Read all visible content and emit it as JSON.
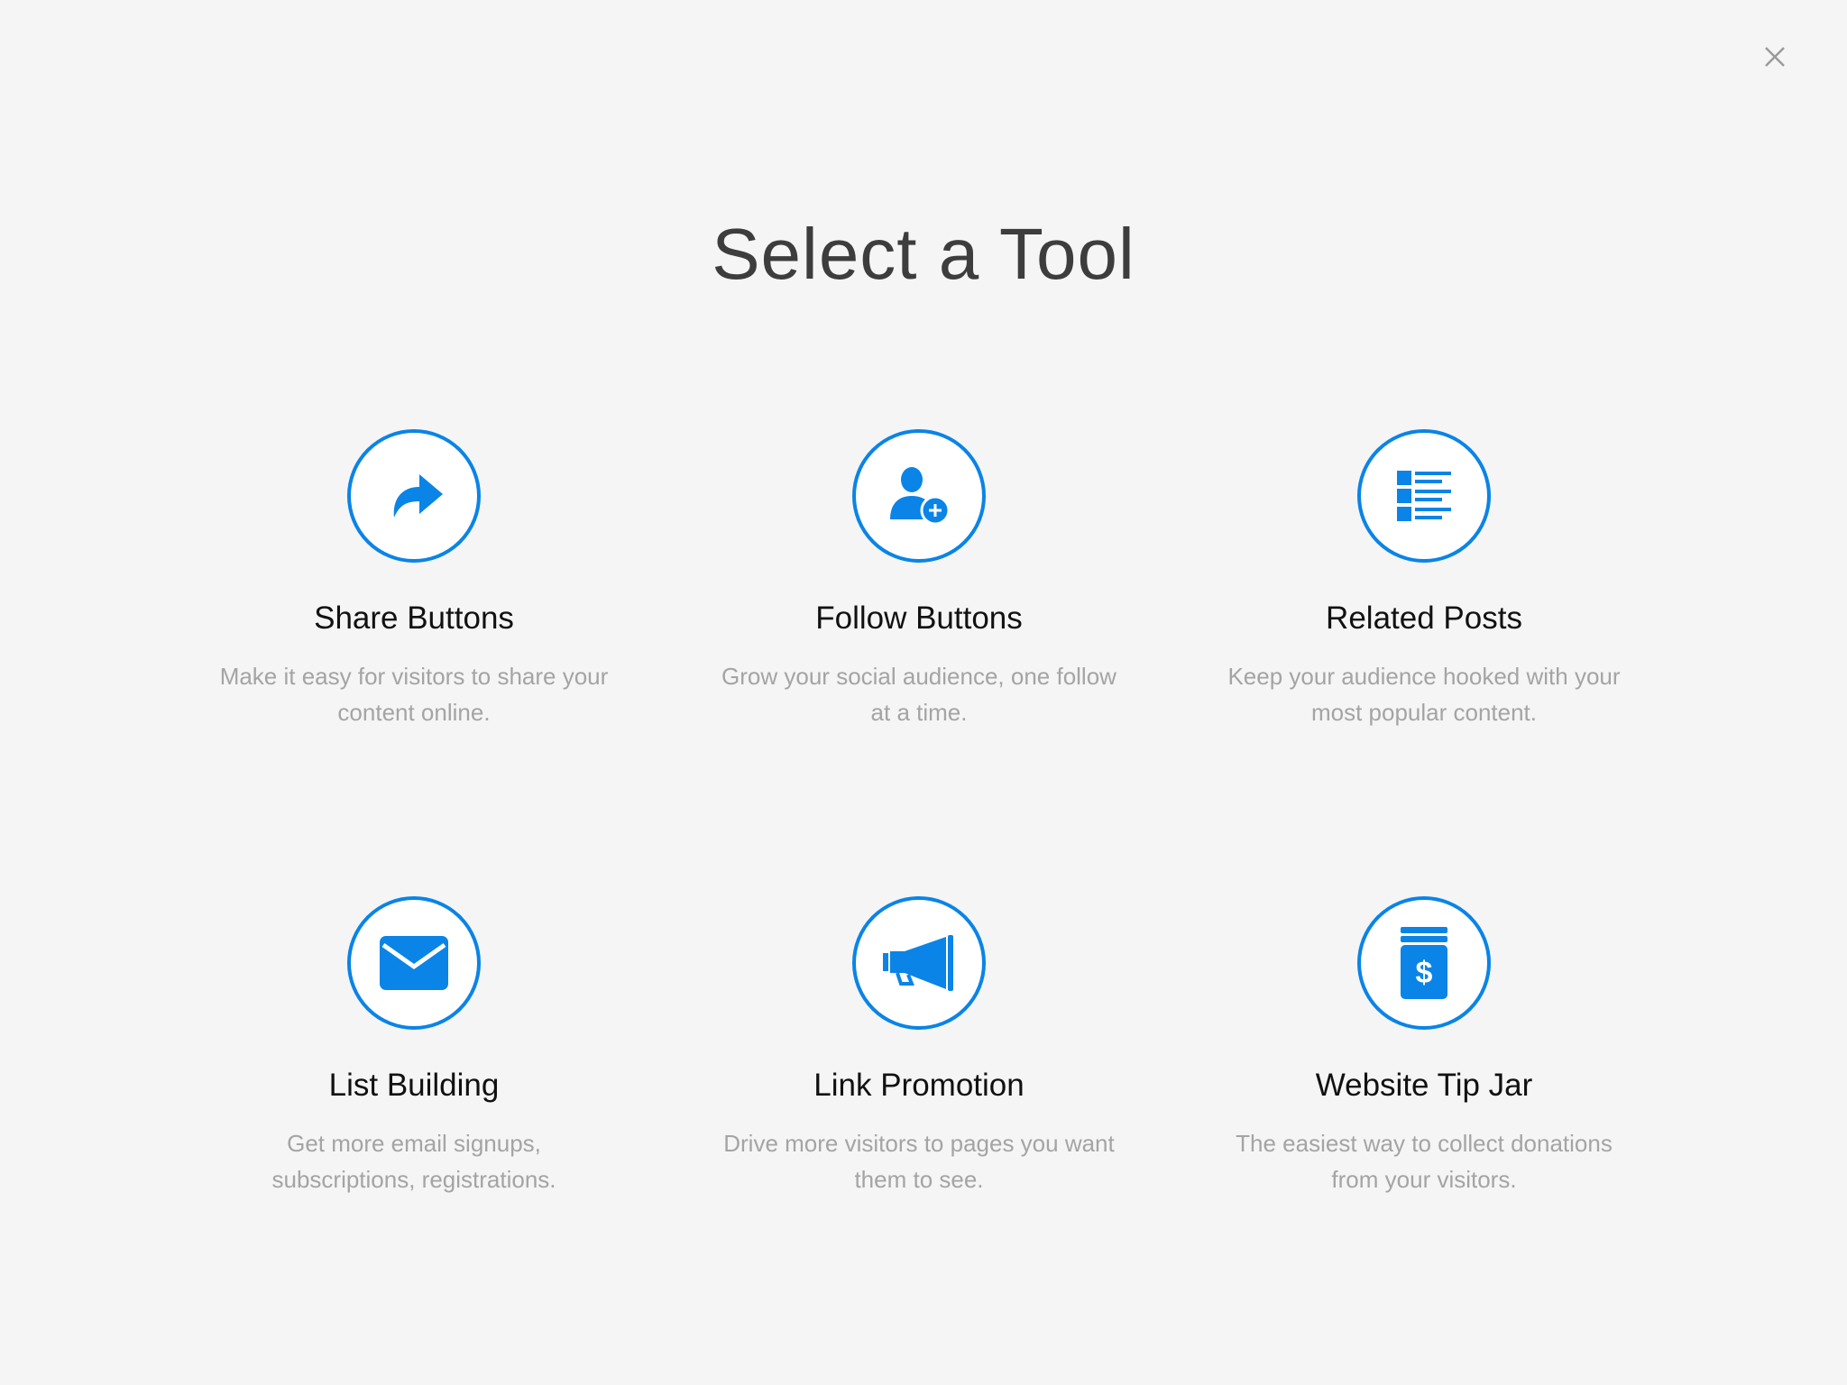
{
  "page": {
    "title": "Select a Tool",
    "close_icon": "close-icon",
    "accent_color": "#0a84e6"
  },
  "tools": [
    {
      "name": "Share Buttons",
      "description": "Make it easy for visitors to share your content online.",
      "icon": "share-arrow-icon"
    },
    {
      "name": "Follow Buttons",
      "description": "Grow your social audience, one follow at a time.",
      "icon": "add-follower-icon"
    },
    {
      "name": "Related Posts",
      "description": "Keep your audience hooked with your most popular content.",
      "icon": "list-icon"
    },
    {
      "name": "List Building",
      "description": "Get more email signups, subscriptions, registrations.",
      "icon": "envelope-icon"
    },
    {
      "name": "Link Promotion",
      "description": "Drive more visitors to pages you want them to see.",
      "icon": "megaphone-icon"
    },
    {
      "name": "Website Tip Jar",
      "description": "The easiest way to collect donations from your visitors.",
      "icon": "tip-jar-icon"
    }
  ]
}
